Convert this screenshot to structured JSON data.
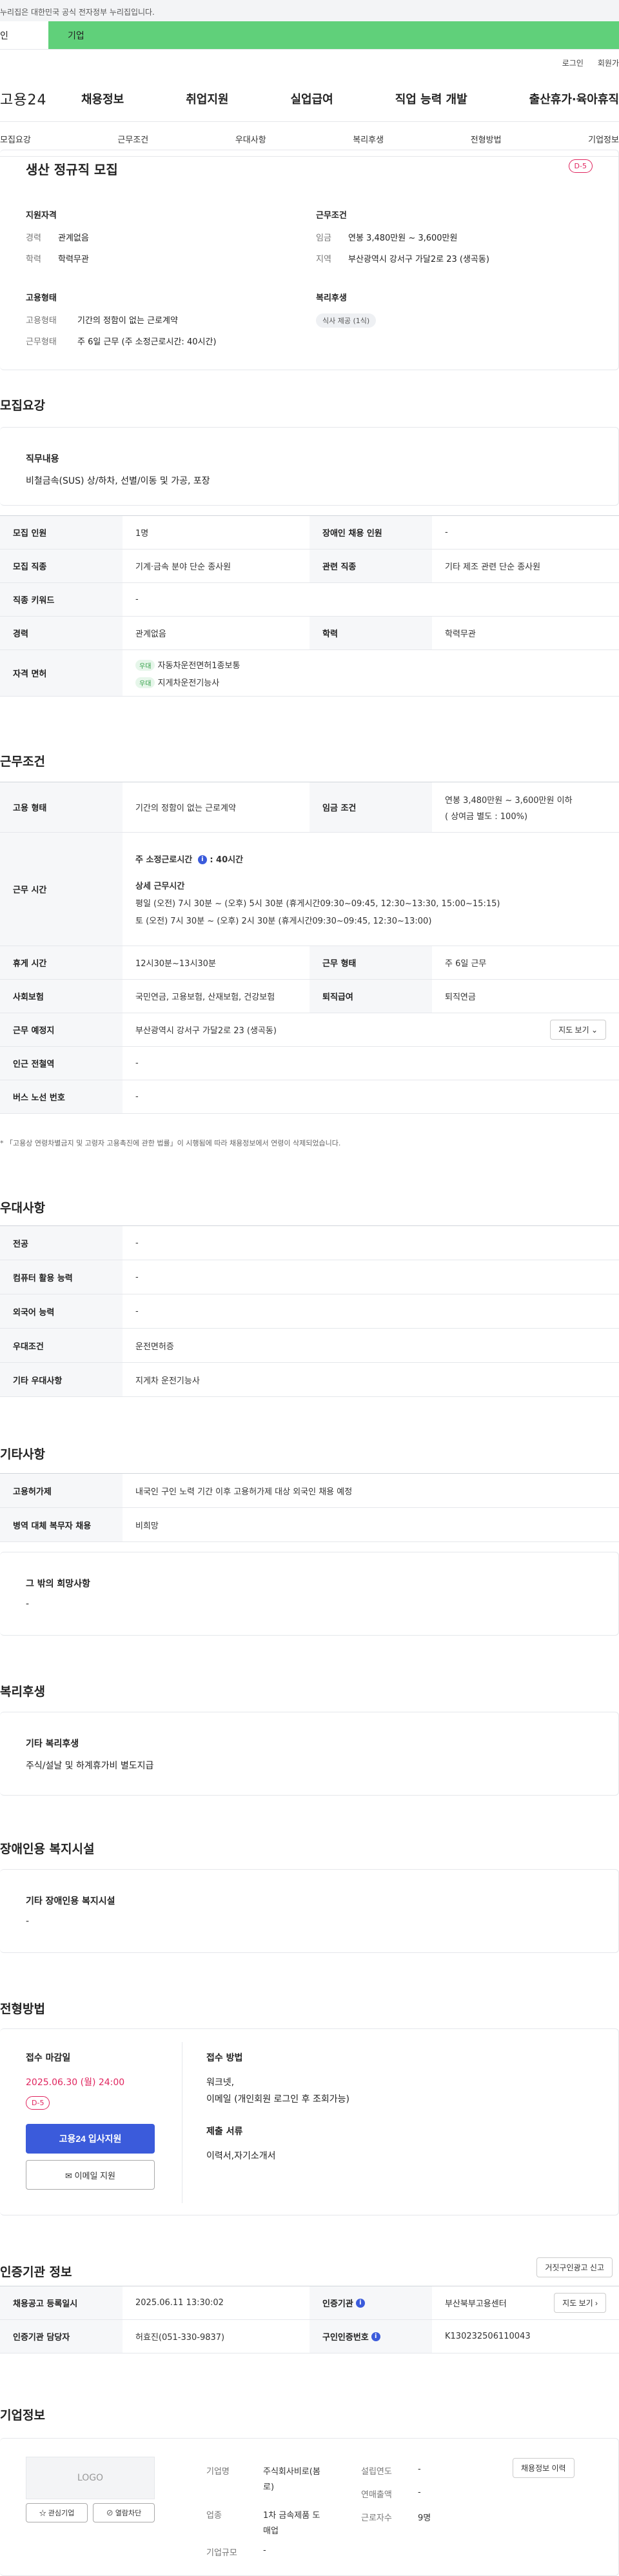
{
  "gov_banner": "누리집은 대한민국 공식 전자정부 누리집입니다.",
  "tabs": {
    "personal": "인",
    "company": "기업"
  },
  "util_links": [
    "로그인",
    "회원가"
  ],
  "gnb": {
    "logo": "고용24",
    "menu": [
      "채용정보",
      "취업지원",
      "실업급여",
      "직업 능력 개발",
      "출산휴가·육아휴직"
    ]
  },
  "subnav": [
    "모집요강",
    "근무조건",
    "우대사항",
    "복리후생",
    "전형방법",
    "기업정보"
  ],
  "summary": {
    "title": "생산 정규직 모집",
    "dday": "D-5",
    "qual_heading": "지원자격",
    "qual": [
      {
        "k": "경력",
        "v": "관계없음"
      },
      {
        "k": "학력",
        "v": "학력무관"
      }
    ],
    "work_heading": "근무조건",
    "work": [
      {
        "k": "임금",
        "v": "연봉 3,480만원 ~ 3,600만원"
      },
      {
        "k": "지역",
        "v": "부산광역시 강서구 가달2로 23 (생곡동)"
      }
    ],
    "emp_heading": "고용형태",
    "emp": [
      {
        "k": "고용형태",
        "v": "기간의 정함이 없는 근로계약"
      },
      {
        "k": "근무형태",
        "v": "주 6일 근무 (주 소정근로시간: 40시간)"
      }
    ],
    "welfare_heading": "복리후생",
    "welfare_chip": "식사 제공 (1식)"
  },
  "recruit": {
    "title": "모집요강",
    "duty_heading": "직무내용",
    "duty_text": "비철금속(SUS) 상/하차, 선별/이동 및 가공, 포장",
    "rows": {
      "count_k": "모집 인원",
      "count_v": "1명",
      "disabled_k": "장애인 채용 인원",
      "disabled_v": "-",
      "job_k": "모집 직종",
      "job_v": "기계·금속 분야 단순 종사원",
      "rel_k": "관련 직종",
      "rel_v": "기타 제조 관련 단순 종사원",
      "kw_k": "직종 키워드",
      "kw_v": "-",
      "career_k": "경력",
      "career_v": "관계없음",
      "edu_k": "학력",
      "edu_v": "학력무관",
      "lic_k": "자격 면허",
      "lic_tag": "우대",
      "lic1": "지게차운전기능사",
      "lic2": "자동차운전면허1종보통"
    }
  },
  "conditions": {
    "title": "근무조건",
    "type_k": "고용 형태",
    "type_v": "기간의 정함이 없는 근로계약",
    "wage_k": "임금 조건",
    "wage_v1": "연봉 3,480만원 ~ 3,600만원 이하",
    "wage_v2": "( 상여금 별도 : 100%)",
    "time_k": "근무 시간",
    "time_std": "주 소정근로시간",
    "time_std_v": ": 40시간",
    "time_detail_h": "상세 근무시간",
    "time_detail_1": "평일 (오전) 7시 30분 ~ (오후) 5시 30분 (휴게시간09:30~09:45, 12:30~13:30, 15:00~15:15)",
    "time_detail_2": "토 (오전) 7시 30분 ~ (오후) 2시 30분 (휴게시간09:30~09:45, 12:30~13:00)",
    "rest_k": "휴게 시간",
    "rest_v": "12시30분~13시30분",
    "shift_k": "근무 형태",
    "shift_v": "주 6일 근무",
    "ins_k": "사회보험",
    "ins_v": "국민연금, 고용보험, 산재보험, 건강보험",
    "sev_k": "퇴직급여",
    "sev_v": "퇴직연금",
    "loc_k": "근무 예정지",
    "loc_v": "부산광역시 강서구 가달2로 23 (생곡동)",
    "map_btn": "지도 보기 ⌄",
    "station_k": "인근 전철역",
    "station_v": "-",
    "bus_k": "버스 노선 번호",
    "bus_v": "-",
    "footnote": "* 「고용상 연령차별금지 및 고령자 고용촉진에 관한 법률」이 시행됨에 따라 채용정보에서 연령이 삭제되었습니다."
  },
  "preferred": {
    "title": "우대사항",
    "rows": [
      {
        "k": "전공",
        "v": "-"
      },
      {
        "k": "컴퓨터 활용 능력",
        "v": "-"
      },
      {
        "k": "외국어 능력",
        "v": "-"
      },
      {
        "k": "우대조건",
        "v": "운전면허증"
      },
      {
        "k": "기타 우대사항",
        "v": "지게차 운전기능사"
      }
    ]
  },
  "etc": {
    "title": "기타사항",
    "rows": [
      {
        "k": "고용허가제",
        "v": "내국인 구인 노력 기간 이후 고용허가제 대상 외국인 채용 예정"
      },
      {
        "k": "병역 대체 복무자 채용",
        "v": "비희망"
      }
    ],
    "other_h": "그 밖의 희망사항",
    "other_v": "-"
  },
  "welfare": {
    "title": "복리후생",
    "h": "기타 복리후생",
    "v": "주식/설날 및 하계휴가비 별도지급"
  },
  "disability": {
    "title": "장애인용 복지시설",
    "h": "기타 장애인용 복지시설",
    "v": "-"
  },
  "screening": {
    "title": "전형방법",
    "deadline_h": "접수 마감일",
    "deadline_v": "2025.06.30 (월) 24:00",
    "dday": "D-5",
    "apply_btn": "고용24 입사지원",
    "mail_btn": "✉ 이메일 지원",
    "method_h": "접수 방법",
    "method_v1": "워크넷,",
    "method_v2": "이메일 (개인회원 로그인 후 조회가능)",
    "docs_h": "제출 서류",
    "docs_v": "이력서,자기소개서"
  },
  "agency": {
    "title": "인증기관 정보",
    "report_btn": "거짓구인광고 신고",
    "reg_k": "채용공고 등록일시",
    "reg_v": "2025.06.11 13:30:02",
    "org_k": "인증기관",
    "org_v": "부산북부고용센터",
    "map_btn": "지도 보기 ›",
    "mgr_k": "인증기관 담당자",
    "mgr_v": "허효진(051-330-9837)",
    "no_k": "구인인증번호",
    "no_v": "K130232506110043"
  },
  "company": {
    "title": "기업정보",
    "logo": "LOGO",
    "fav_btn": "☆ 관심기업",
    "block_btn": "⊘ 열람차단",
    "detail_btn": "채용정보 이력",
    "name_k": "기업명",
    "name_v1": "주식회사비로(봄",
    "name_v2": "로)",
    "ind_k": "업종",
    "ind_v1": "1차 금속제품 도",
    "ind_v2": "매업",
    "size_k": "기업규모",
    "size_v": "-",
    "year_k": "설립연도",
    "year_v": "-",
    "sales_k": "연매출액",
    "sales_v": "-",
    "emp_k": "근로자수",
    "emp_v": "9명"
  }
}
